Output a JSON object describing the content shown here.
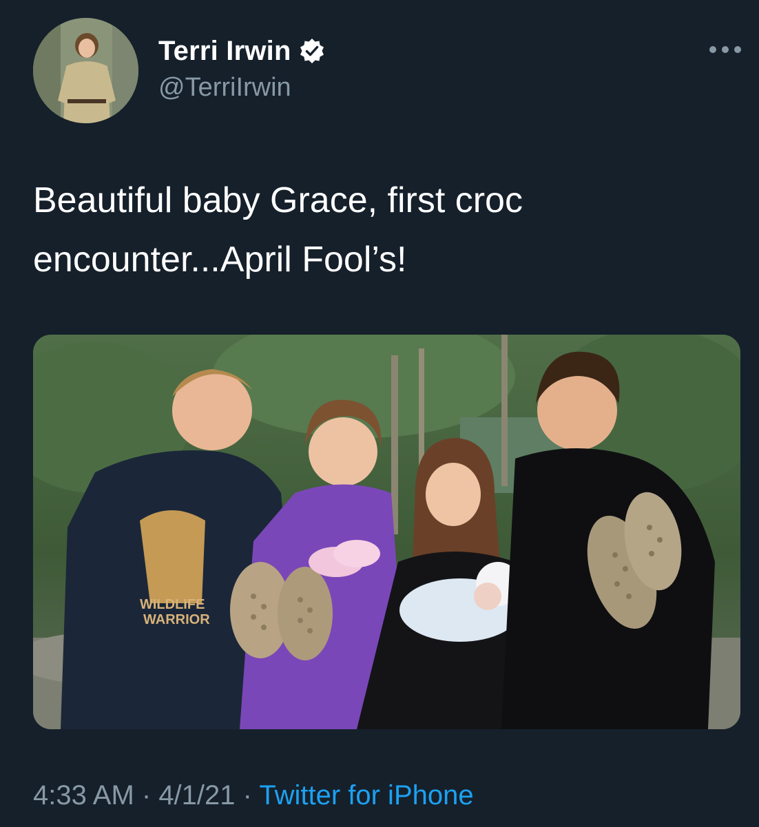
{
  "author": {
    "display_name": "Terri Irwin",
    "handle": "@TerriIrwin",
    "verified": true,
    "avatar_icon": "profile-photo"
  },
  "more_icon": "more-horizontal-icon",
  "tweet": {
    "text": "Beautiful baby Grace, first croc encounter...April Fool’s!",
    "media_icon": "photo",
    "shirt_text": "WILDLIFE\nWARRIOR"
  },
  "meta": {
    "time": "4:33 AM",
    "separator": " · ",
    "date": "4/1/21",
    "source": "Twitter for iPhone"
  },
  "colors": {
    "background": "#15202b",
    "secondary_text": "#8899a6",
    "accent": "#1da1f2",
    "verified_badge": "#ffffff"
  }
}
